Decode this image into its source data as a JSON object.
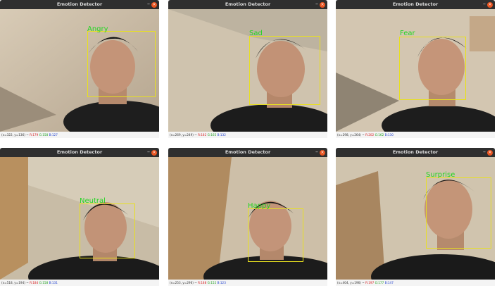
{
  "windows": [
    {
      "title": "Emotion Detector",
      "emotion": "Angry",
      "status": {
        "coords": "(x=322, y=136) ~",
        "r": "R:179",
        "g": "G:158",
        "b": "B:127"
      }
    },
    {
      "title": "Emotion Detector",
      "emotion": "Sad",
      "status": {
        "coords": "(x=269, y=249) ~",
        "r": "R:182",
        "g": "G:165",
        "b": "B:132"
      }
    },
    {
      "title": "Emotion Detector",
      "emotion": "Fear",
      "status": {
        "coords": "(x=298, y=264) ~",
        "r": "R:202",
        "g": "G:162",
        "b": "B:130"
      }
    },
    {
      "title": "Emotion Detector",
      "emotion": "Neutral",
      "status": {
        "coords": "(x=518, y=194) ~",
        "r": "R:184",
        "g": "G:158",
        "b": "B:131"
      }
    },
    {
      "title": "Emotion Detector",
      "emotion": "Happy",
      "status": {
        "coords": "(x=253, y=296) ~",
        "r": "R:188",
        "g": "G:152",
        "b": "B:123"
      }
    },
    {
      "title": "Emotion Detector",
      "emotion": "Surprise",
      "status": {
        "coords": "(x=404, y=196) ~",
        "r": "R:197",
        "g": "G:177",
        "b": "B:147"
      }
    }
  ],
  "controls": {
    "minimize_glyph": "–",
    "close_glyph": "×"
  },
  "colors": {
    "titlebar": "#2f2f2f",
    "close_button": "#e95420",
    "bbox": "#e8e020",
    "label": "#22d622"
  },
  "icons": [
    "minimize-icon",
    "close-icon"
  ]
}
